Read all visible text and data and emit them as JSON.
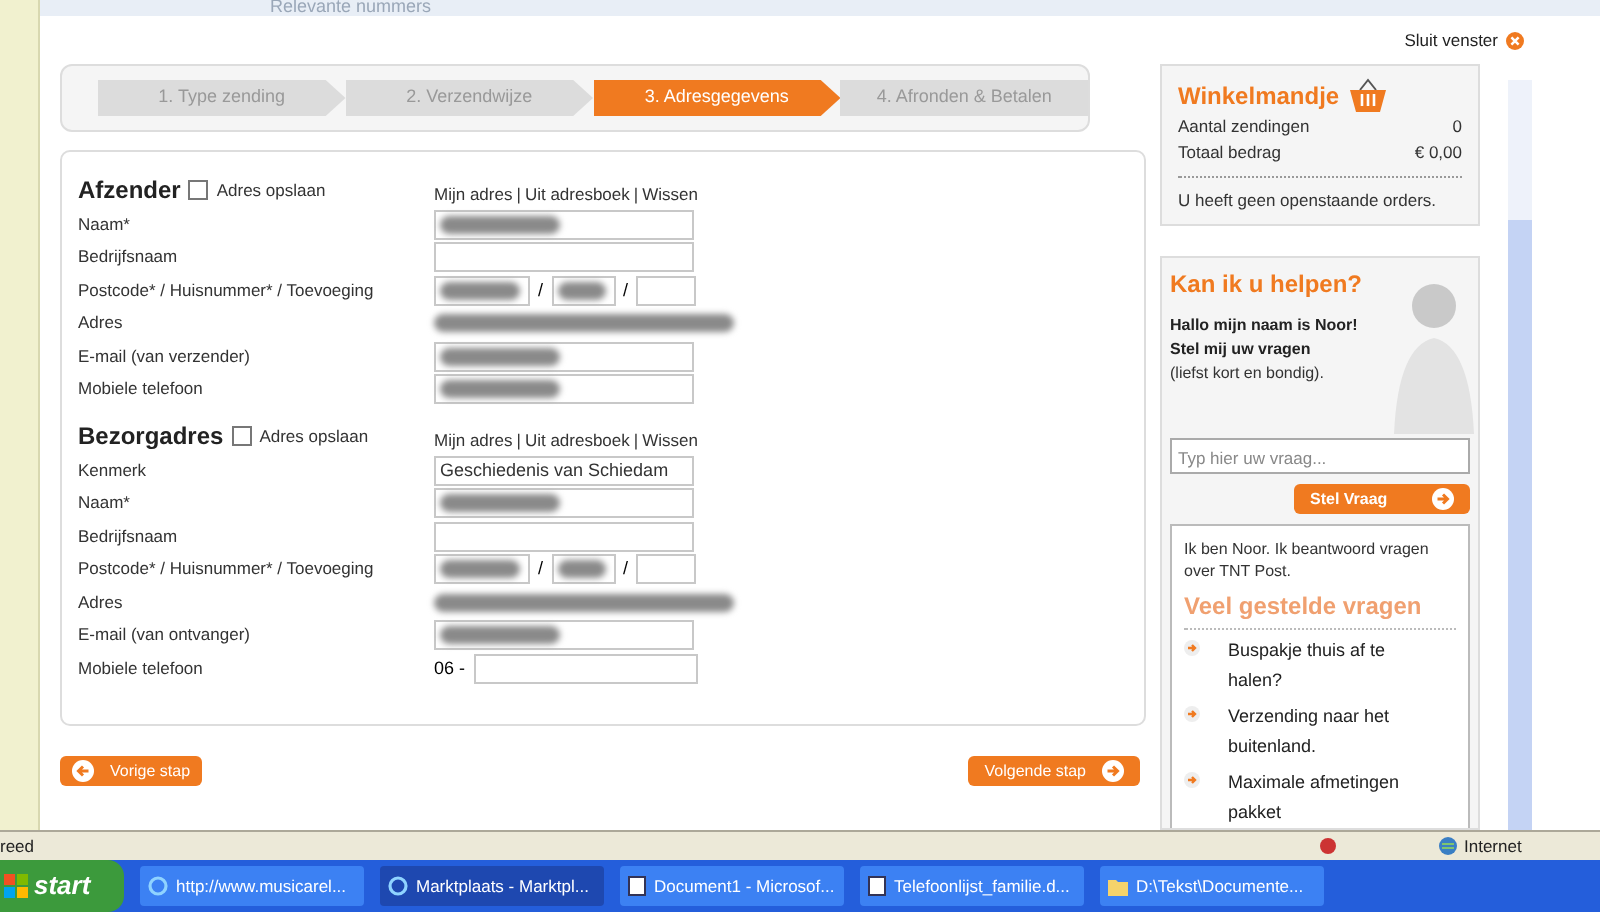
{
  "background_page": {
    "heading": "Relevante nummers"
  },
  "window": {
    "close_label": "Sluit venster"
  },
  "steps": [
    {
      "label": "1. Type zending",
      "selected": false
    },
    {
      "label": "2. Verzendwijze",
      "selected": false
    },
    {
      "label": "3. Adresgegevens",
      "selected": true
    },
    {
      "label": "4. Afronden & Betalen",
      "selected": false
    }
  ],
  "sections": [
    {
      "title": "Afzender",
      "link_separator": "|",
      "postcode_separator": "/",
      "save_label": "Adres opslaan",
      "save_checked": false,
      "links": [
        "Mijn adres",
        "Uit adresboek",
        "Wissen"
      ],
      "fields": [
        {
          "kind": "text",
          "label": "Naam*",
          "redacted": true
        },
        {
          "kind": "text",
          "label": "Bedrijfsnaam",
          "redacted": false
        },
        {
          "kind": "postcode",
          "label": "Postcode* / Huisnummer* / Toevoeging",
          "redacted": true
        },
        {
          "kind": "address",
          "label": "Adres",
          "redacted": true
        },
        {
          "kind": "text",
          "label": "E-mail (van verzender)",
          "redacted": true
        },
        {
          "kind": "text",
          "label": "Mobiele telefoon",
          "redacted": true
        }
      ]
    },
    {
      "title": "Bezorgadres",
      "link_separator": "|",
      "postcode_separator": "/",
      "save_label": "Adres opslaan",
      "save_checked": false,
      "links": [
        "Mijn adres",
        "Uit adresboek",
        "Wissen"
      ],
      "fields": [
        {
          "kind": "text",
          "label": "Kenmerk",
          "value": "Geschiedenis van Schiedam"
        },
        {
          "kind": "text",
          "label": "Naam*",
          "redacted": true
        },
        {
          "kind": "text",
          "label": "Bedrijfsnaam",
          "redacted": false
        },
        {
          "kind": "postcode",
          "label": "Postcode* / Huisnummer* / Toevoeging",
          "redacted": true
        },
        {
          "kind": "address",
          "label": "Adres",
          "redacted": true
        },
        {
          "kind": "text",
          "label": "E-mail (van ontvanger)",
          "redacted": true
        },
        {
          "kind": "phone",
          "label": "Mobiele telefoon",
          "prefix": "06 -",
          "redacted": false
        }
      ]
    }
  ],
  "nav_buttons": {
    "back": "Vorige stap",
    "next": "Volgende stap"
  },
  "cart": {
    "title": "Winkelmandje",
    "rows": [
      {
        "label": "Aantal zendingen",
        "value": "0"
      },
      {
        "label": "Totaal bedrag",
        "value": "€ 0,00"
      }
    ],
    "message": "U heeft geen openstaande orders."
  },
  "help": {
    "title": "Kan ik u helpen?",
    "greeting": "Hallo mijn naam is Noor!",
    "prompt": "Stel mij uw vragen",
    "hint": "(liefst kort en bondig).",
    "placeholder": "Typ hier uw vraag...",
    "button": "Stel Vraag",
    "intro": "Ik ben Noor. Ik beantwoord vragen over TNT Post.",
    "faq_title": "Veel gestelde vragen",
    "faq": [
      "Buspakje thuis af te halen?",
      "Verzending naar het buitenland.",
      "Maximale afmetingen pakket"
    ]
  },
  "status_bar": {
    "text": "reed",
    "zone": "Internet"
  },
  "taskbar": {
    "start": "start",
    "tasks": [
      {
        "label": "http://www.musicarel...",
        "selected": false,
        "kind": "browser"
      },
      {
        "label": "Marktplaats - Marktpl...",
        "selected": true,
        "kind": "browser"
      },
      {
        "label": "Document1 - Microsof...",
        "selected": false,
        "kind": "document"
      },
      {
        "label": "Telefoonlijst_familie.d...",
        "selected": false,
        "kind": "document"
      },
      {
        "label": "D:\\Tekst\\Documente...",
        "selected": false,
        "kind": "folder"
      }
    ]
  }
}
